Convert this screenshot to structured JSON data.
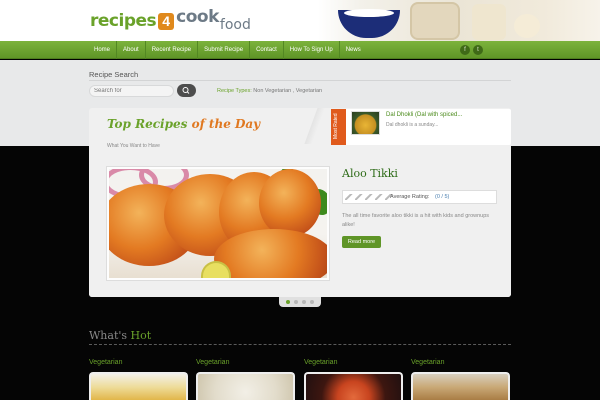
{
  "brand": {
    "logo_part1": "recipes",
    "logo_part2": "4",
    "logo_part3": "cook",
    "logo_part4": "food",
    "green": "#6aa22a",
    "orange": "#e0891c"
  },
  "nav": {
    "items": [
      "Home",
      "About",
      "Recent Recipe",
      "Submit Recipe",
      "Contact",
      "How To Sign Up",
      "News"
    ],
    "social": [
      {
        "icon": "facebook-icon",
        "glyph": "f"
      },
      {
        "icon": "twitter-icon",
        "glyph": "t"
      }
    ]
  },
  "search": {
    "title": "Recipe Search",
    "placeholder": "Search for",
    "recipe_types_label": "Recipe Types:",
    "recipe_types_value": "Non Vegetarian , Vegetarian"
  },
  "top_recipes": {
    "title_part1": "Top Recipes",
    "title_part2": "of the Day",
    "subtitle": "What You Want to Have"
  },
  "most_rated": {
    "ribbon": "Most Rated",
    "title": "Dal Dhokli (Dal with spiced...",
    "desc": "Dal dhokli is a sunday..."
  },
  "featured": {
    "title": "Aloo Tikki",
    "rating_label": "Average Rating:",
    "rating_value": "(0 / 5)",
    "rating_score": 0,
    "rating_max": 5,
    "description": "The all time favorite aloo tikki is a hit with kids and grownups alike!",
    "read_more": "Read more"
  },
  "slider": {
    "count": 4,
    "active": 1
  },
  "whats_hot": {
    "title_part1": "What's",
    "title_part2": "Hot",
    "items": [
      {
        "category": "Vegetarian"
      },
      {
        "category": "Vegetarian"
      },
      {
        "category": "Vegetarian"
      },
      {
        "category": "Vegetarian"
      }
    ]
  }
}
